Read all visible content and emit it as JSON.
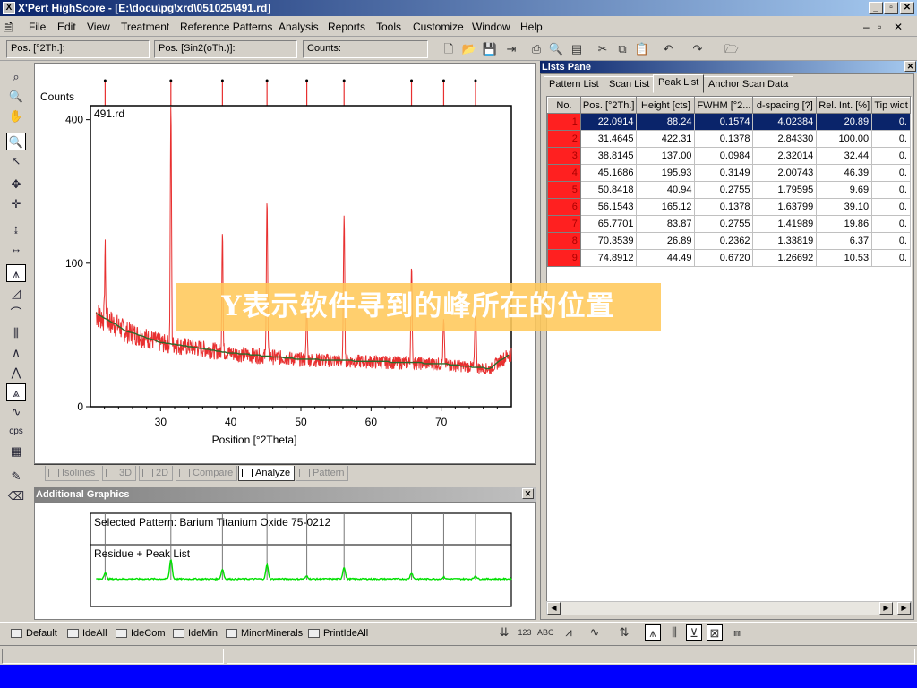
{
  "window": {
    "title": "X'Pert HighScore - [E:\\docu\\pg\\xrd\\051025\\491.rd]",
    "controls": [
      "_",
      "▫",
      "✕"
    ],
    "mdi_controls": [
      "–",
      "▫",
      "✕"
    ]
  },
  "menu": [
    "File",
    "Edit",
    "View",
    "Treatment",
    "Reference Patterns",
    "Analysis",
    "Reports",
    "Tools",
    "Customize",
    "Window",
    "Help"
  ],
  "toolbar": {
    "pos_2th": "Pos. [°2Th.]:",
    "pos_sin2": "Pos. [Sin2(oTh.)]:",
    "counts": "Counts:"
  },
  "plot": {
    "pattern_name": "491.rd",
    "ylabel": "Counts",
    "xlabel": "Position [°2Theta]",
    "ytick_labels": [
      "400",
      "100",
      "0"
    ],
    "xtick_labels": [
      "30",
      "40",
      "50",
      "60",
      "70"
    ]
  },
  "chart_data": {
    "type": "line",
    "title": "491.rd",
    "xlabel": "Position [°2Theta]",
    "ylabel": "Counts",
    "xlim": [
      20,
      80
    ],
    "yscale": "sqrt",
    "ylim": [
      0,
      440
    ],
    "yticks": [
      0,
      100,
      400
    ],
    "xticks": [
      30,
      40,
      50,
      60,
      70
    ],
    "background_level": [
      {
        "x": 20,
        "y": 45
      },
      {
        "x": 25,
        "y": 28
      },
      {
        "x": 30,
        "y": 20
      },
      {
        "x": 40,
        "y": 14
      },
      {
        "x": 50,
        "y": 11
      },
      {
        "x": 60,
        "y": 10
      },
      {
        "x": 70,
        "y": 9
      },
      {
        "x": 77,
        "y": 7
      },
      {
        "x": 80,
        "y": 14
      }
    ],
    "peak_markers_x": [
      22.0914,
      31.4645,
      38.8145,
      45.1686,
      50.8418,
      56.1543,
      65.7701,
      70.3539,
      74.8912
    ],
    "peak_heights": [
      88.24,
      422.31,
      137.0,
      195.93,
      40.94,
      165.12,
      83.87,
      26.89,
      44.49
    ],
    "series_color": "#e83030",
    "background_color": "#2a6a2a"
  },
  "overlay_text": "Y表示软件寻到的峰所在的位置",
  "view_tabs": [
    {
      "label": "Isolines",
      "active": false
    },
    {
      "label": "3D",
      "active": false
    },
    {
      "label": "2D",
      "active": false
    },
    {
      "label": "Compare",
      "active": false
    },
    {
      "label": "Analyze",
      "active": true
    },
    {
      "label": "Pattern",
      "active": false
    }
  ],
  "additional_graphics": {
    "title": "Additional Graphics",
    "selected_pattern": "Selected Pattern: Barium Titanium Oxide  75-0212",
    "residue_label": "Residue + Peak List",
    "residue_color": "#00e000"
  },
  "lists_pane": {
    "title": "Lists Pane",
    "tabs": [
      "Pattern List",
      "Scan List",
      "Peak List",
      "Anchor Scan Data"
    ],
    "active_tab": "Peak List",
    "columns": [
      "No.",
      "Pos. [°2Th.]",
      "Height [cts]",
      "FWHM [°2...",
      "d-spacing [?]",
      "Rel. Int. [%]",
      "Tip widt"
    ],
    "rows": [
      [
        "1",
        "22.0914",
        "88.24",
        "0.1574",
        "4.02384",
        "20.89",
        "0."
      ],
      [
        "2",
        "31.4645",
        "422.31",
        "0.1378",
        "2.84330",
        "100.00",
        "0."
      ],
      [
        "3",
        "38.8145",
        "137.00",
        "0.0984",
        "2.32014",
        "32.44",
        "0."
      ],
      [
        "4",
        "45.1686",
        "195.93",
        "0.3149",
        "2.00743",
        "46.39",
        "0."
      ],
      [
        "5",
        "50.8418",
        "40.94",
        "0.2755",
        "1.79595",
        "9.69",
        "0."
      ],
      [
        "6",
        "56.1543",
        "165.12",
        "0.1378",
        "1.63799",
        "39.10",
        "0."
      ],
      [
        "7",
        "65.7701",
        "83.87",
        "0.2755",
        "1.41989",
        "19.86",
        "0."
      ],
      [
        "8",
        "70.3539",
        "26.89",
        "0.2362",
        "1.33819",
        "6.37",
        "0."
      ],
      [
        "9",
        "74.8912",
        "44.49",
        "0.6720",
        "1.26692",
        "10.53",
        "0."
      ]
    ],
    "selected_row": 0
  },
  "macros": [
    "Default",
    "IdeAll",
    "IdeCom",
    "IdeMin",
    "MinorMinerals",
    "PrintIdeAll"
  ],
  "left_tool_icons": [
    "zoom-reset-icon",
    "zoom-out-icon",
    "hand-pan-icon",
    "zoom-in-icon",
    "pointer-icon",
    "move-icon",
    "crosshair-icon",
    "y-scale-icon",
    "x-scale-icon",
    "peak-search-icon",
    "background-icon",
    "fit-profile-icon",
    "bar-chart-icon",
    "peak-shape-icon",
    "multi-peak-icon",
    "peak-list-icon",
    "pattern-icon",
    "cps-icon",
    "grid-icon",
    "pen-icon",
    "eraser-icon"
  ],
  "cps_label": "cps"
}
